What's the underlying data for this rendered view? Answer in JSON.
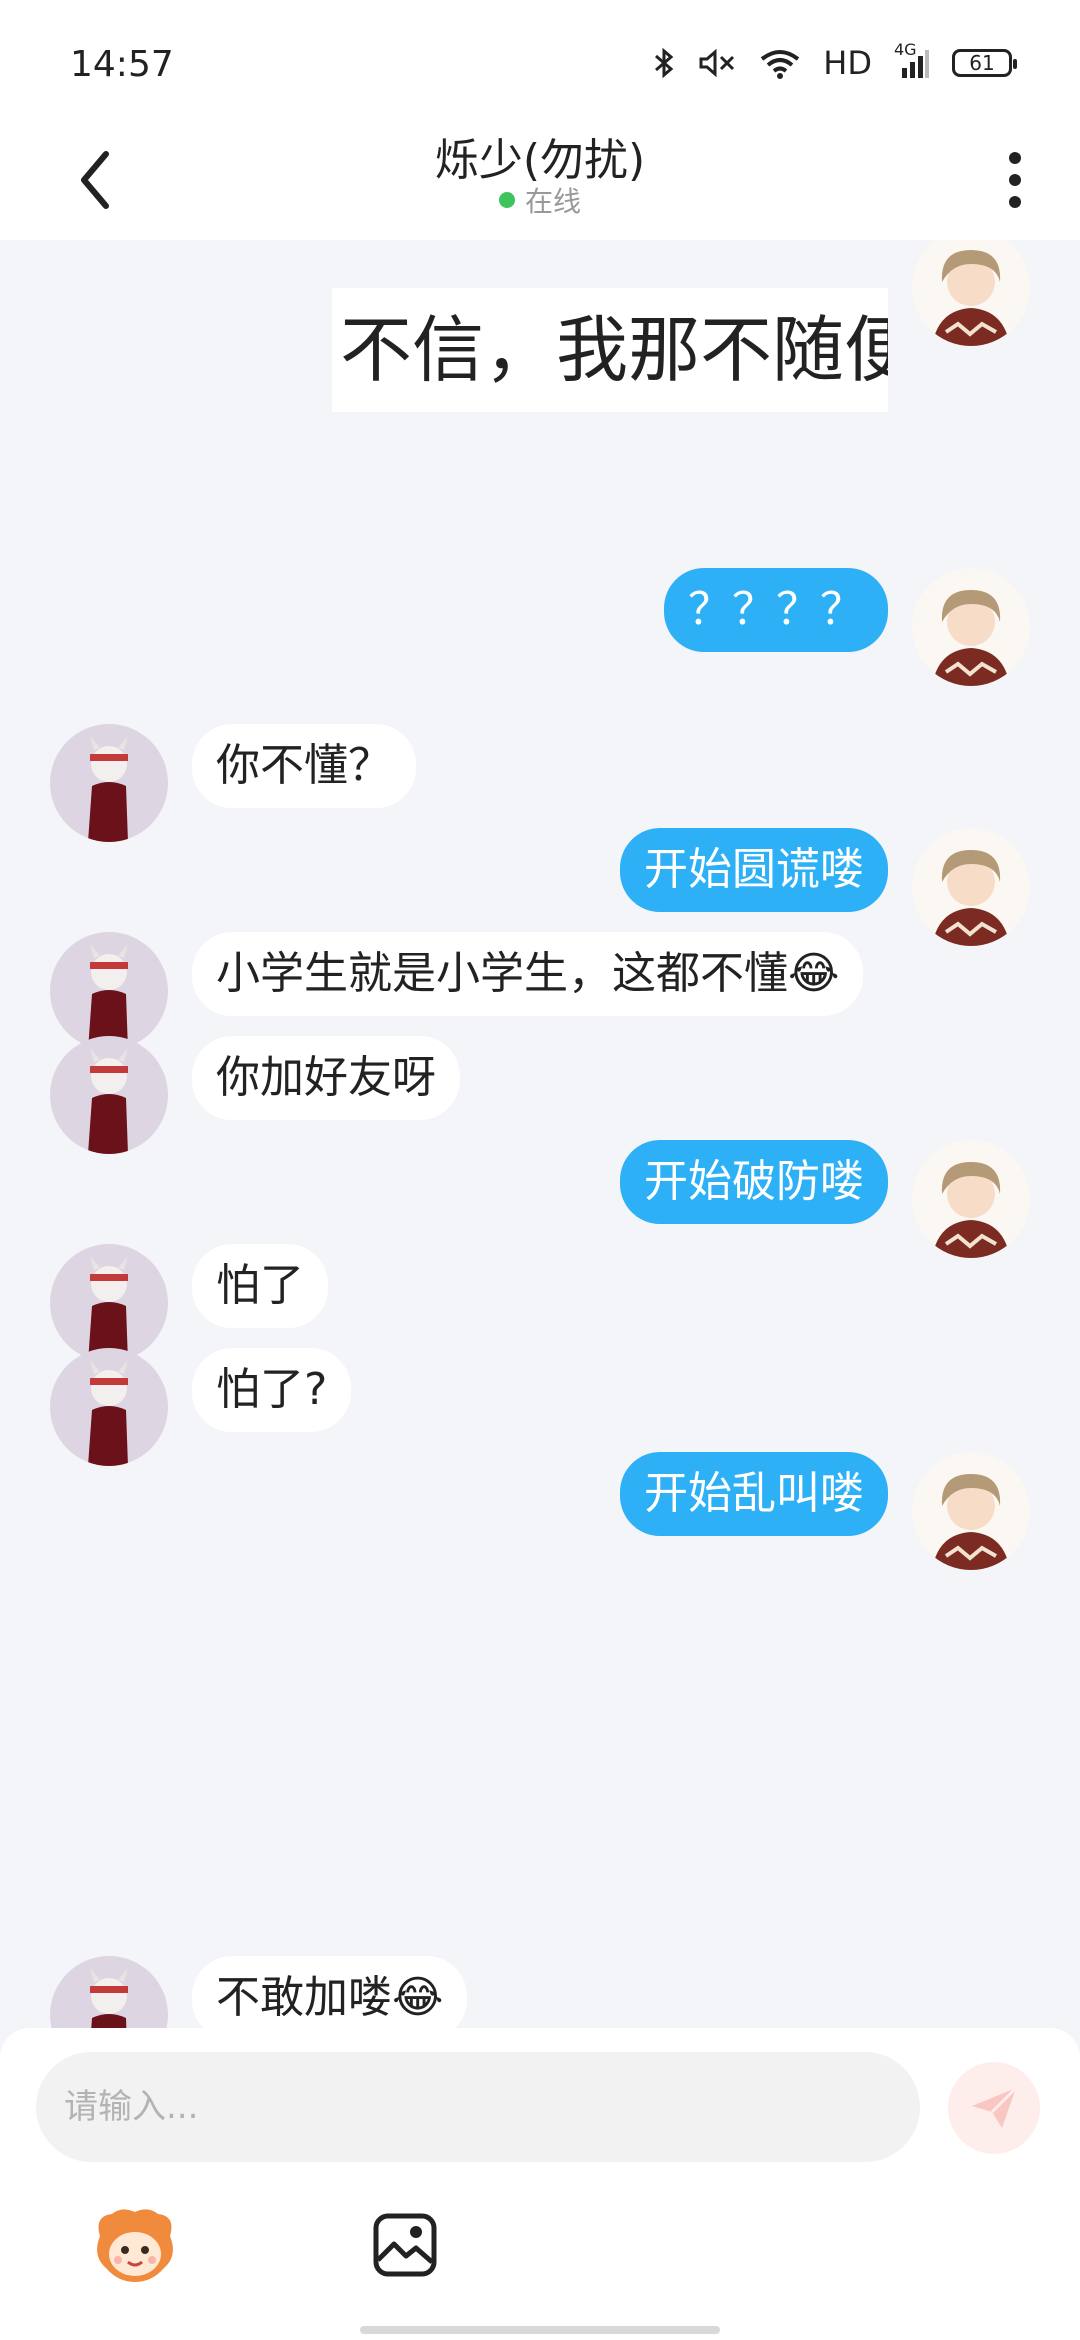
{
  "status_bar": {
    "time": "14:57",
    "network": "HD",
    "signal_type": "4G",
    "battery": "61",
    "icons": [
      "bluetooth-icon",
      "mute-icon",
      "wifi-icon",
      "signal-icon",
      "battery-icon"
    ]
  },
  "header": {
    "title": "烁少(勿扰)",
    "status": "在线",
    "status_color": "#3dc45b",
    "icons": [
      "back-icon",
      "more-icon"
    ]
  },
  "messages": [
    {
      "direction": "out",
      "type": "image",
      "text": "不信，我那不随便"
    },
    {
      "direction": "out",
      "type": "text",
      "text": "？？？？"
    },
    {
      "direction": "in",
      "type": "text",
      "text": "你不懂？"
    },
    {
      "direction": "out",
      "type": "text",
      "text": "开始圆谎喽"
    },
    {
      "direction": "in",
      "type": "text",
      "text": "小学生就是小学生，这都不懂😂"
    },
    {
      "direction": "in",
      "type": "text",
      "text": "你加好友呀"
    },
    {
      "direction": "out",
      "type": "text",
      "text": "开始破防喽"
    },
    {
      "direction": "in",
      "type": "text",
      "text": "怕了"
    },
    {
      "direction": "in",
      "type": "text",
      "text": "怕了?"
    },
    {
      "direction": "out",
      "type": "text",
      "text": "开始乱叫喽"
    },
    {
      "direction": "in",
      "type": "text",
      "text": "不敢加喽😂"
    }
  ],
  "input": {
    "placeholder": "请输入..."
  },
  "toolbar": {
    "icons": [
      "mascot-icon",
      "image-icon",
      "send-icon"
    ]
  },
  "colors": {
    "outgoing_bubble": "#2db0f5",
    "incoming_bubble": "#ffffff",
    "chat_background": "#f4f5f9",
    "send_button": "#fdeeec"
  }
}
